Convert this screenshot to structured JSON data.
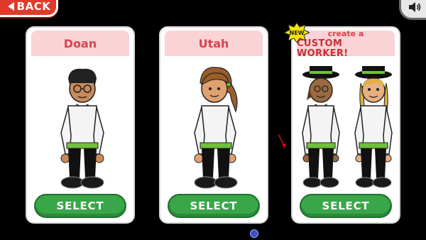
{
  "nav": {
    "back_label": "BACK",
    "sound_icon": "speaker-icon"
  },
  "cards": [
    {
      "title": "Doan",
      "select_label": "SELECT"
    },
    {
      "title": "Utah",
      "select_label": "SELECT"
    },
    {
      "title_line1": "create a",
      "title_line2": "CUSTOM WORKER!",
      "badge": "NEW",
      "select_label": "SELECT"
    }
  ],
  "colors": {
    "accent_red": "#d7444c",
    "select_green": "#39a64a",
    "header_pink": "#f9d3d6",
    "back_red": "#e03a2a"
  }
}
